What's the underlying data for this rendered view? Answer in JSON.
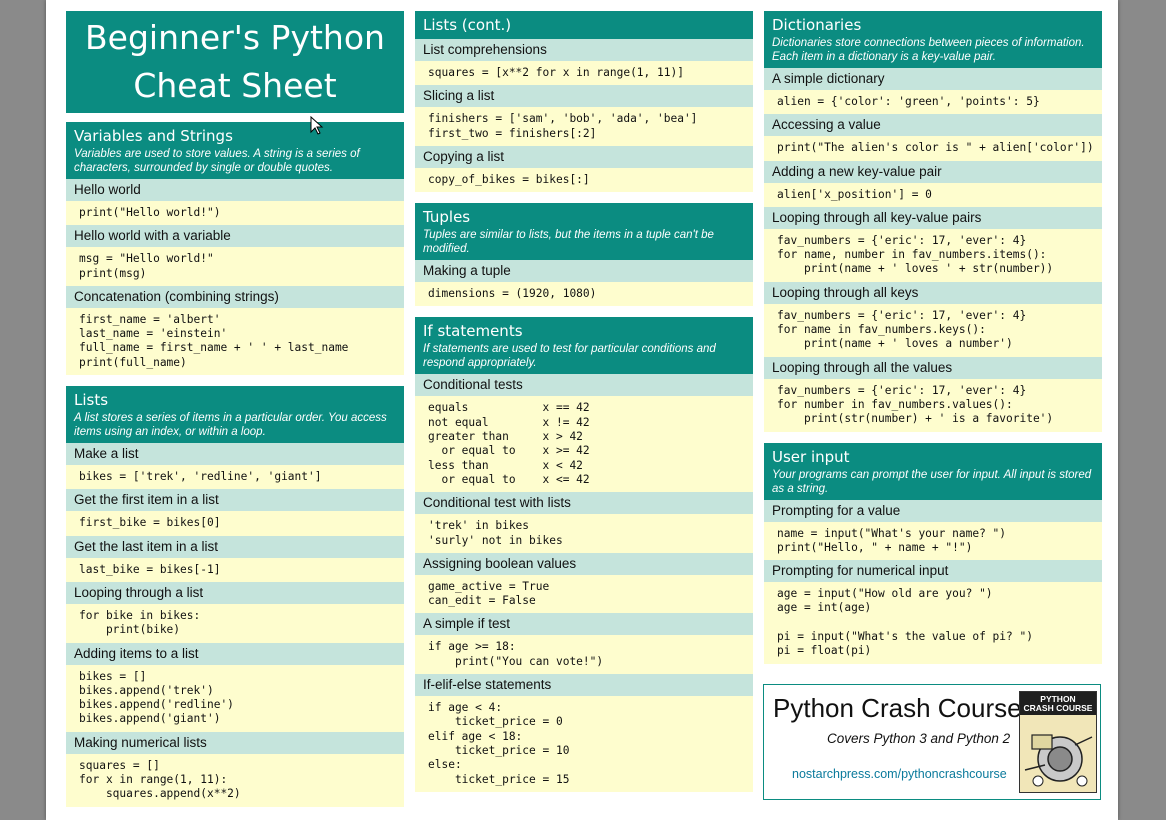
{
  "sheet_title": "Beginner's Python\nCheat Sheet",
  "col1": [
    {
      "title": "Variables and Strings",
      "desc": "Variables are used to store values. A string is a series of characters, surrounded by single or double quotes.",
      "items": [
        {
          "label": "Hello world",
          "code": "print(\"Hello world!\")"
        },
        {
          "label": "Hello world with a variable",
          "code": "msg = \"Hello world!\"\nprint(msg)"
        },
        {
          "label": "Concatenation (combining strings)",
          "code": "first_name = 'albert'\nlast_name = 'einstein'\nfull_name = first_name + ' ' + last_name\nprint(full_name)"
        }
      ]
    },
    {
      "title": "Lists",
      "desc": "A list stores a series of items in a particular order. You access items using an index, or within a loop.",
      "items": [
        {
          "label": "Make a list",
          "code": "bikes = ['trek', 'redline', 'giant']"
        },
        {
          "label": "Get the first item in a list",
          "code": "first_bike = bikes[0]"
        },
        {
          "label": "Get the last item in a list",
          "code": "last_bike = bikes[-1]"
        },
        {
          "label": "Looping through a list",
          "code": "for bike in bikes:\n    print(bike)"
        },
        {
          "label": "Adding items to a list",
          "code": "bikes = []\nbikes.append('trek')\nbikes.append('redline')\nbikes.append('giant')"
        },
        {
          "label": "Making numerical lists",
          "code": "squares = []\nfor x in range(1, 11):\n    squares.append(x**2)"
        }
      ]
    }
  ],
  "col2": [
    {
      "title": "Lists (cont.)",
      "desc": "",
      "items": [
        {
          "label": "List comprehensions",
          "code": "squares = [x**2 for x in range(1, 11)]"
        },
        {
          "label": "Slicing a list",
          "code": "finishers = ['sam', 'bob', 'ada', 'bea']\nfirst_two = finishers[:2]"
        },
        {
          "label": "Copying a list",
          "code": "copy_of_bikes = bikes[:]"
        }
      ]
    },
    {
      "title": "Tuples",
      "desc": "Tuples are similar to lists, but the items in a tuple can't be modified.",
      "items": [
        {
          "label": "Making a tuple",
          "code": "dimensions = (1920, 1080)"
        }
      ]
    },
    {
      "title": "If statements",
      "desc": "If statements are used to test for particular conditions and respond appropriately.",
      "items": [
        {
          "label": "Conditional tests",
          "code": "equals           x == 42\nnot equal        x != 42\ngreater than     x > 42\n  or equal to    x >= 42\nless than        x < 42\n  or equal to    x <= 42"
        },
        {
          "label": "Conditional test with lists",
          "code": "'trek' in bikes\n'surly' not in bikes"
        },
        {
          "label": "Assigning boolean values",
          "code": "game_active = True\ncan_edit = False"
        },
        {
          "label": "A simple if test",
          "code": "if age >= 18:\n    print(\"You can vote!\")"
        },
        {
          "label": "If-elif-else statements",
          "code": "if age < 4:\n    ticket_price = 0\nelif age < 18:\n    ticket_price = 10\nelse:\n    ticket_price = 15"
        }
      ]
    }
  ],
  "col3": [
    {
      "title": "Dictionaries",
      "desc": "Dictionaries store connections between pieces of information. Each item in a dictionary is a key-value pair.",
      "items": [
        {
          "label": "A simple dictionary",
          "code": "alien = {'color': 'green', 'points': 5}"
        },
        {
          "label": "Accessing a value",
          "code": "print(\"The alien's color is \" + alien['color'])"
        },
        {
          "label": "Adding a new key-value pair",
          "code": "alien['x_position'] = 0"
        },
        {
          "label": "Looping through all key-value pairs",
          "code": "fav_numbers = {'eric': 17, 'ever': 4}\nfor name, number in fav_numbers.items():\n    print(name + ' loves ' + str(number))"
        },
        {
          "label": "Looping through all keys",
          "code": "fav_numbers = {'eric': 17, 'ever': 4}\nfor name in fav_numbers.keys():\n    print(name + ' loves a number')"
        },
        {
          "label": "Looping through all the values",
          "code": "fav_numbers = {'eric': 17, 'ever': 4}\nfor number in fav_numbers.values():\n    print(str(number) + ' is a favorite')"
        }
      ]
    },
    {
      "title": "User input",
      "desc": "Your programs can prompt the user for input. All input is stored as a string.",
      "items": [
        {
          "label": "Prompting for a value",
          "code": "name = input(\"What's your name? \")\nprint(\"Hello, \" + name + \"!\")"
        },
        {
          "label": "Prompting for numerical input",
          "code": "age = input(\"How old are you? \")\nage = int(age)\n\npi = input(\"What's the value of pi? \")\npi = float(pi)"
        }
      ]
    }
  ],
  "promo": {
    "title": "Python Crash Course",
    "subtitle": "Covers Python 3 and Python 2",
    "link": "nostarchpress.com/pythoncrashcourse",
    "book_title": "PYTHON\nCRASH COURSE"
  },
  "colors": {
    "header": "#0b8c81",
    "label_bg": "#c5e4dc",
    "code_bg": "#fefdce",
    "link": "#0b7a9c"
  }
}
